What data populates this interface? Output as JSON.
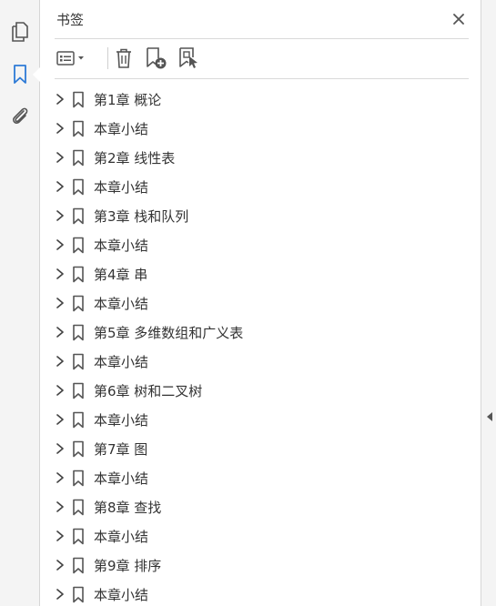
{
  "panel": {
    "title": "书签",
    "close_icon": "close-icon"
  },
  "rail": {
    "items": [
      {
        "name": "pages-icon",
        "active": false
      },
      {
        "name": "bookmark-icon",
        "active": true
      },
      {
        "name": "attachment-icon",
        "active": false
      }
    ]
  },
  "toolbar": {
    "items": [
      "options-menu-icon",
      "delete-icon",
      "new-bookmark-icon",
      "new-bookmark-from-structure-icon"
    ]
  },
  "bookmarks": [
    {
      "label": "第1章  概论"
    },
    {
      "label": "本章小结"
    },
    {
      "label": "第2章  线性表"
    },
    {
      "label": "本章小结"
    },
    {
      "label": "第3章  栈和队列"
    },
    {
      "label": "本章小结"
    },
    {
      "label": "第4章  串"
    },
    {
      "label": "本章小结"
    },
    {
      "label": "第5章  多维数组和广义表"
    },
    {
      "label": "本章小结"
    },
    {
      "label": "第6章  树和二叉树"
    },
    {
      "label": "本章小结"
    },
    {
      "label": "第7章  图"
    },
    {
      "label": "本章小结"
    },
    {
      "label": "第8章  查找"
    },
    {
      "label": "本章小结"
    },
    {
      "label": "第9章  排序"
    },
    {
      "label": "本章小结"
    }
  ],
  "colors": {
    "accent": "#2d7ad6",
    "icon": "#555555",
    "text": "#333333"
  }
}
